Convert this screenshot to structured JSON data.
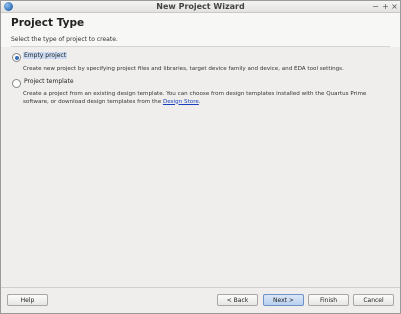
{
  "window": {
    "title": "New Project Wizard",
    "controls": {
      "minimize": "−",
      "maximize": "+",
      "close": "×"
    }
  },
  "header": {
    "title": "Project Type",
    "subtitle": "Select the type of project to create."
  },
  "options": [
    {
      "label": "Empty project",
      "selected": true,
      "description": "Create new project by specifying project files and libraries, target device family and device, and EDA tool settings."
    },
    {
      "label": "Project template",
      "selected": false,
      "description_line1": "Create a project from an existing design template. You can choose from design templates installed with the Quartus Prime",
      "description_line2_prefix": "software, or download design templates from the ",
      "description_link": "Design Store",
      "description_line2_suffix": "."
    }
  ],
  "footer": {
    "help": "Help",
    "back": "< Back",
    "next": "Next >",
    "finish": "Finish",
    "cancel": "Cancel"
  }
}
